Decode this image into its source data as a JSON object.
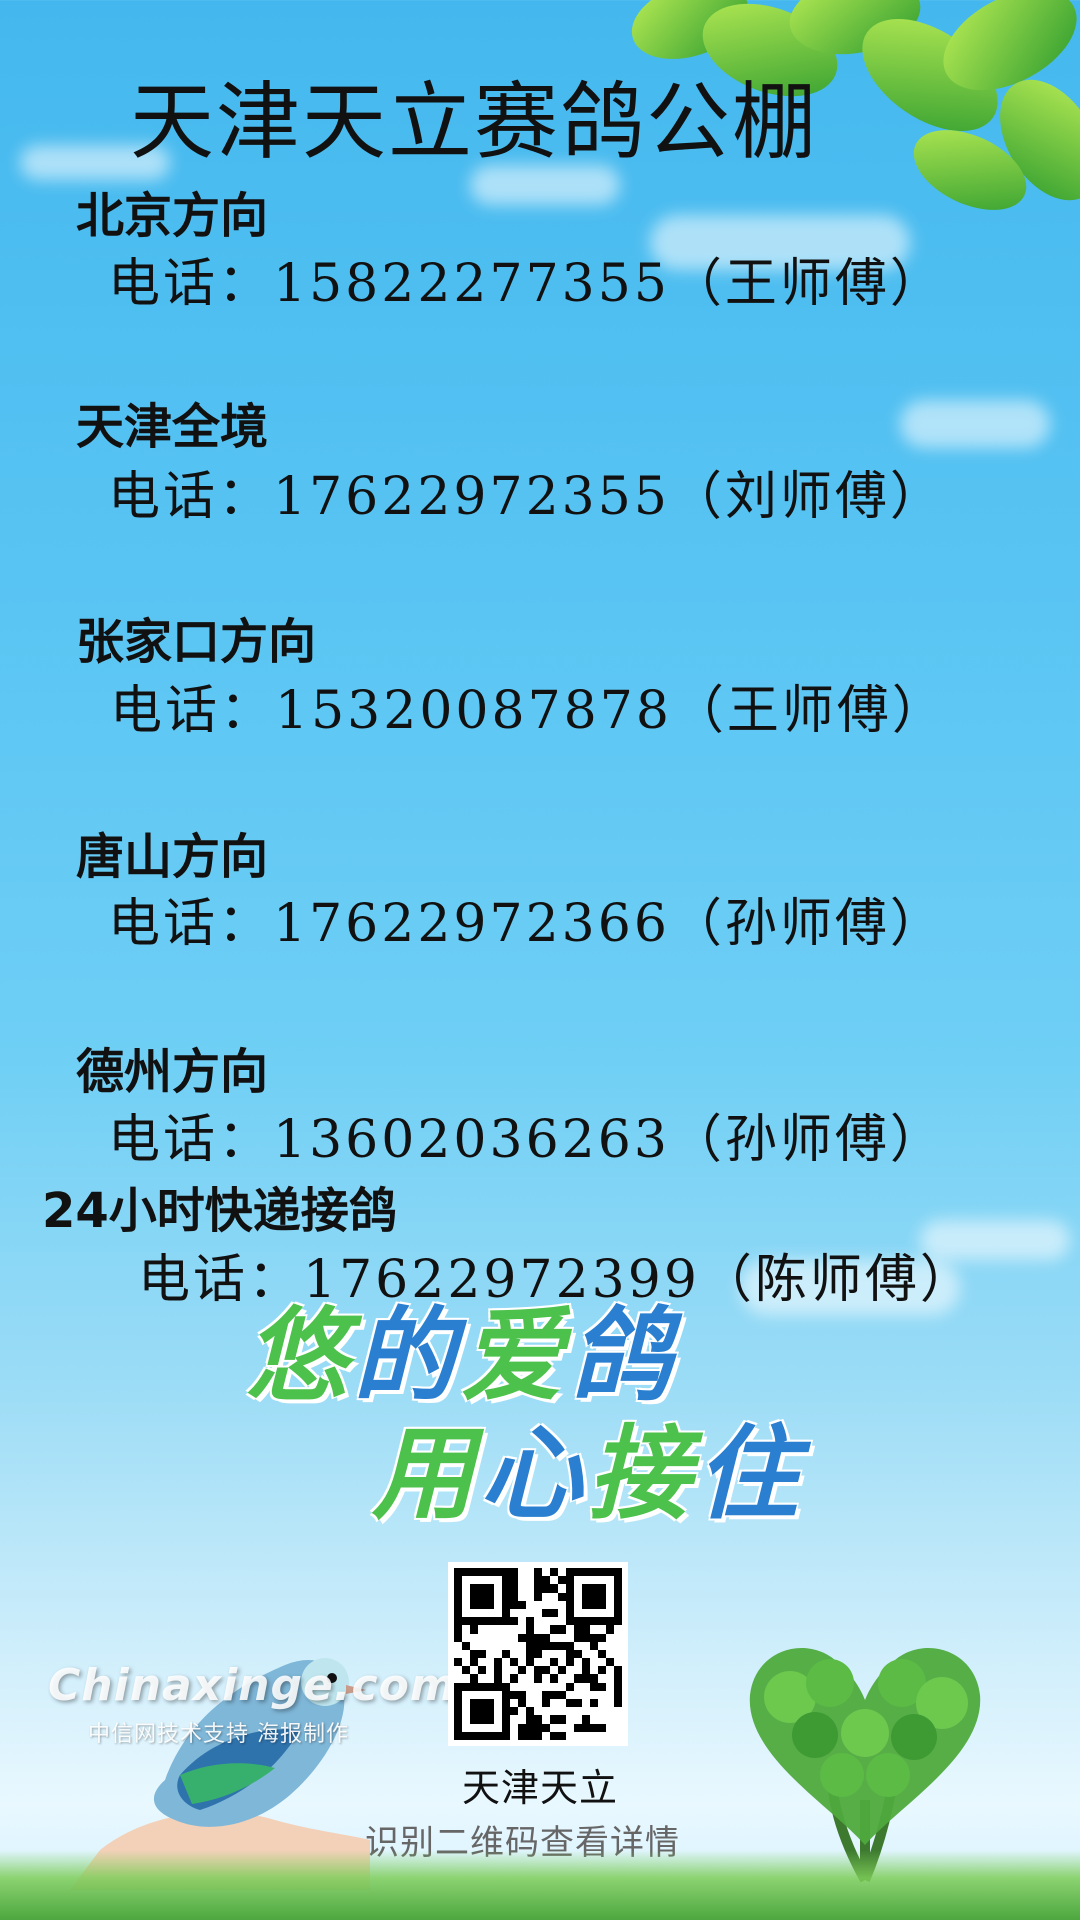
{
  "title": "天津天立赛鸽公棚",
  "routes": [
    {
      "name": "北京方向",
      "phone": "电话：15822277355（王师傅）"
    },
    {
      "name": "天津全境",
      "phone": "电话：17622972355（刘师傅）"
    },
    {
      "name": "张家口方向",
      "phone": "电话：15320087878（王师傅）"
    },
    {
      "name": "唐山方向",
      "phone": "电话：17622972366（孙师傅）"
    },
    {
      "name": "德州方向",
      "phone": "电话：13602036263（孙师傅）"
    },
    {
      "name": "24小时快递接鸽",
      "phone": "电话：17622972399（陈师傅）"
    }
  ],
  "slogan": {
    "line1": [
      "悠",
      "的",
      "爱",
      "鸽"
    ],
    "line2": [
      "用",
      "心",
      "接",
      "住"
    ]
  },
  "watermark": {
    "brand": "Chinaxinge.com",
    "subtitle": "中信网技术支持 海报制作"
  },
  "qr": {
    "caption": "天津天立",
    "tip": "识别二维码查看详情"
  },
  "colors": {
    "sky_top": "#44b8ee",
    "sky_bottom": "#d4f1ff",
    "slogan_green": "#4cc14b",
    "slogan_blue": "#2a7fd0",
    "text_dark": "#111111"
  },
  "icons": [
    "leaf-icon",
    "pigeon-icon",
    "hand-icon",
    "heart-tree-icon",
    "qr-code-icon"
  ]
}
